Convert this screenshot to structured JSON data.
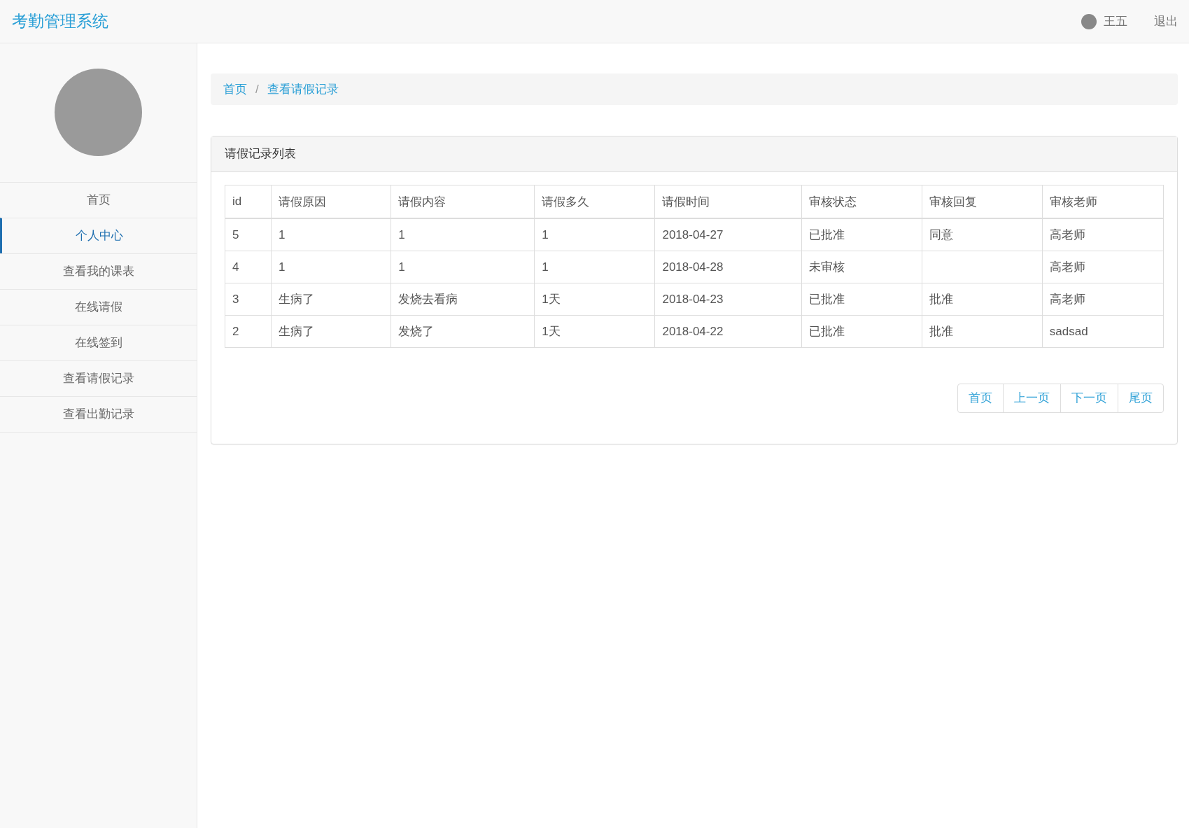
{
  "header": {
    "title": "考勤管理系统",
    "user": "王五",
    "logout": "退出"
  },
  "sidebar": {
    "items": [
      {
        "label": "首页",
        "selected": false
      },
      {
        "label": "个人中心",
        "selected": true
      },
      {
        "label": "查看我的课表",
        "selected": false
      },
      {
        "label": "在线请假",
        "selected": false
      },
      {
        "label": "在线签到",
        "selected": false
      },
      {
        "label": "查看请假记录",
        "selected": false
      },
      {
        "label": "查看出勤记录",
        "selected": false
      }
    ]
  },
  "breadcrumb": {
    "items": [
      "首页",
      "查看请假记录"
    ],
    "separator": "/"
  },
  "panel": {
    "title": "请假记录列表"
  },
  "table": {
    "columns": [
      "id",
      "请假原因",
      "请假内容",
      "请假多久",
      "请假时间",
      "审核状态",
      "审核回复",
      "审核老师"
    ],
    "rows": [
      [
        "5",
        "1",
        "1",
        "1",
        "2018-04-27",
        "已批准",
        "同意",
        "高老师"
      ],
      [
        "4",
        "1",
        "1",
        "1",
        "2018-04-28",
        "未审核",
        "",
        "高老师"
      ],
      [
        "3",
        "生病了",
        "发烧去看病",
        "1天",
        "2018-04-23",
        "已批准",
        "批准",
        "高老师"
      ],
      [
        "2",
        "生病了",
        "发烧了",
        "1天",
        "2018-04-22",
        "已批准",
        "批准",
        "sadsad"
      ]
    ]
  },
  "pagination": [
    "首页",
    "上一页",
    "下一页",
    "尾页"
  ]
}
